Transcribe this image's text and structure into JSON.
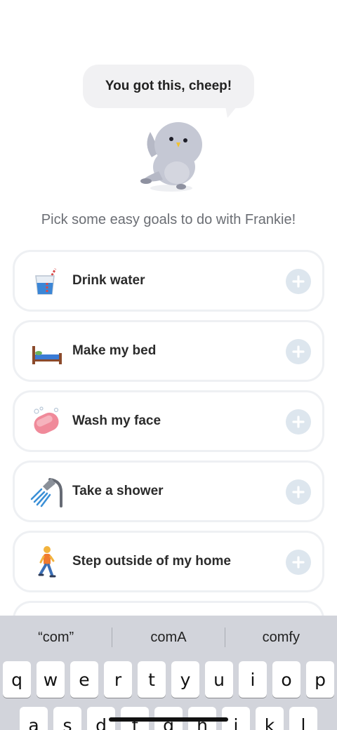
{
  "speech_bubble": {
    "text": "You got this, cheep!"
  },
  "mascot": {
    "icon": "bird-mascot-icon",
    "color": "#c5c8d4"
  },
  "subtitle": "Pick some easy goals to do with Frankie!",
  "goals": [
    {
      "label": "Drink water",
      "icon": "glass-of-water-icon"
    },
    {
      "label": "Make my bed",
      "icon": "bed-icon"
    },
    {
      "label": "Wash my face",
      "icon": "soap-icon"
    },
    {
      "label": "Take a shower",
      "icon": "shower-icon"
    },
    {
      "label": "Step outside of my home",
      "icon": "person-walking-icon"
    }
  ],
  "colors": {
    "add_button": "#dde6ee",
    "card_border": "#eef0f3",
    "keyboard_bg": "#d2d4db"
  },
  "keyboard": {
    "suggestions": [
      "“com”",
      "comA",
      "comfy"
    ],
    "row1": [
      "q",
      "w",
      "e",
      "r",
      "t",
      "y",
      "u",
      "i",
      "o",
      "p"
    ],
    "row2": [
      "a",
      "s",
      "d",
      "f",
      "g",
      "h",
      "j",
      "k",
      "l"
    ]
  }
}
